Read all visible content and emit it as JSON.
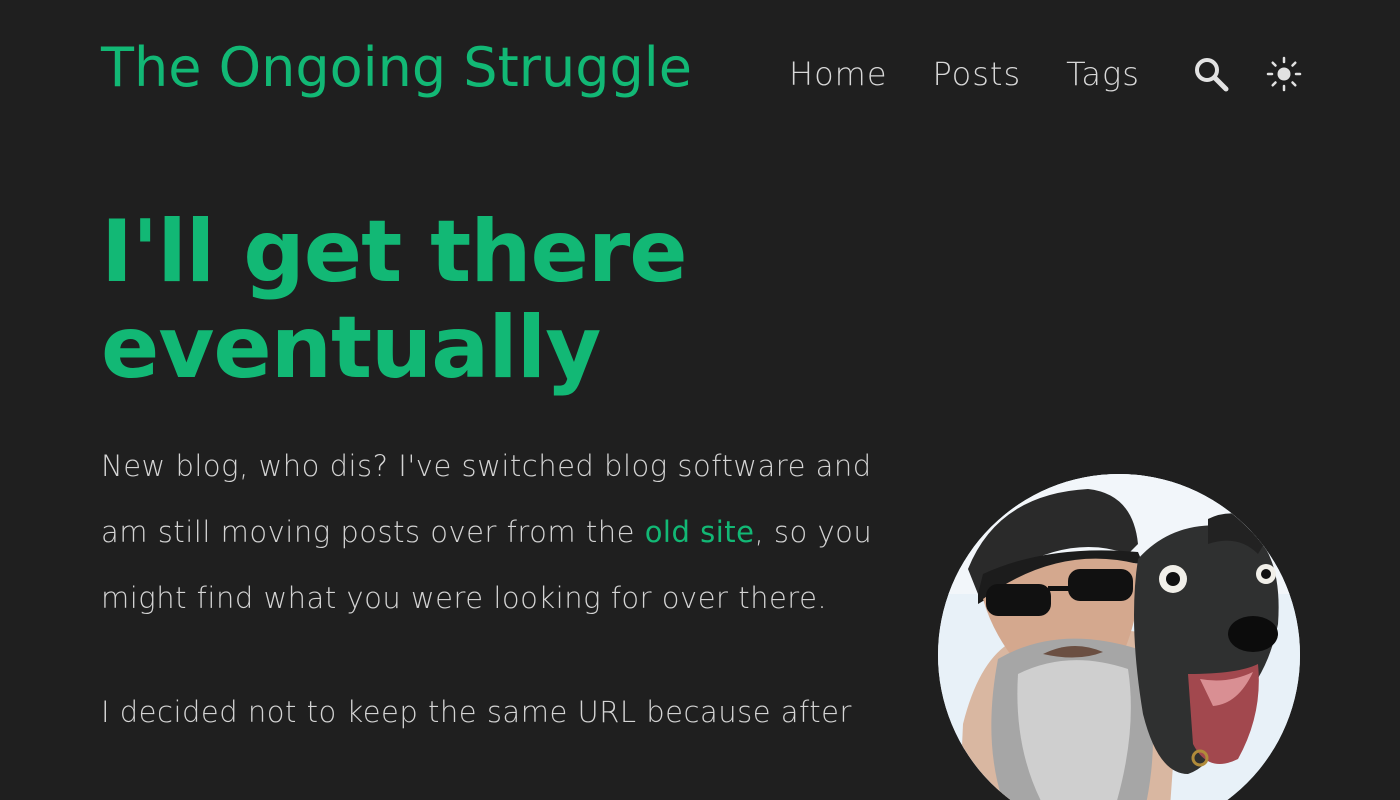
{
  "header": {
    "site_title": "The Ongoing Struggle",
    "nav": [
      {
        "label": "Home"
      },
      {
        "label": "Posts"
      },
      {
        "label": "Tags"
      }
    ],
    "search_icon": "search-icon",
    "theme_icon": "sun-icon"
  },
  "post": {
    "title": "I'll get there eventually",
    "paragraphs": [
      {
        "before_link": "New blog, who dis? I've switched blog software and am still moving posts over from the ",
        "link_text": "old site",
        "after_link": ", so you might find what you were looking for over there."
      },
      {
        "text": "I decided not to keep the same URL because after"
      }
    ]
  },
  "avatar": {
    "description_icon": "avatar-photo"
  },
  "colors": {
    "background": "#1f1f1f",
    "accent": "#12b875",
    "text": "#d4d4d4",
    "nav_text": "#d8d8d8"
  }
}
